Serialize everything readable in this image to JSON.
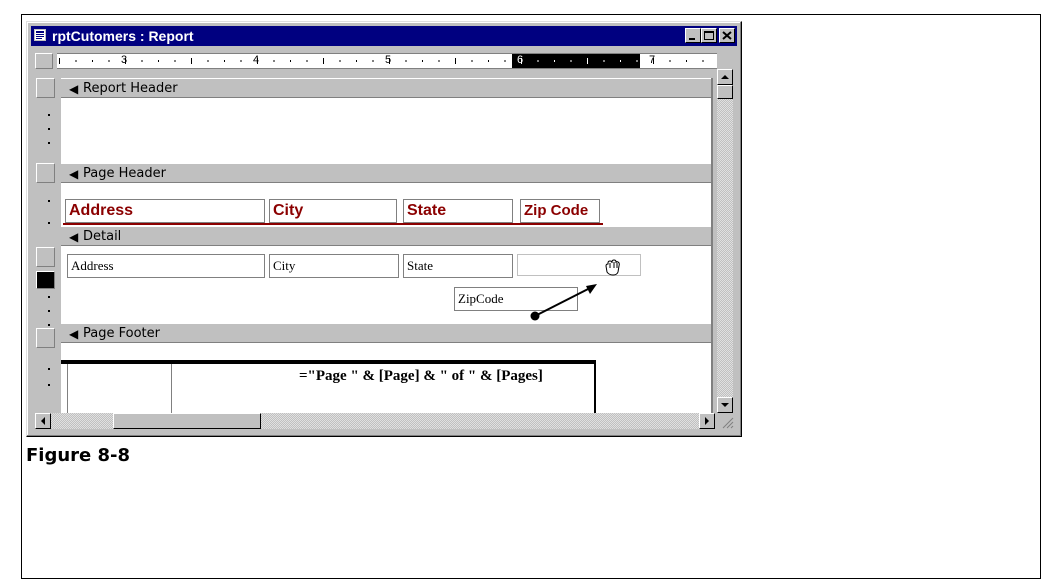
{
  "window": {
    "title": "rptCutomers : Report",
    "buttons": [
      "minimize",
      "maximize",
      "close"
    ]
  },
  "ruler": {
    "labels": [
      "3",
      "4",
      "5",
      "6",
      "7"
    ]
  },
  "sections": {
    "report_header": "Report Header",
    "page_header": "Page Header",
    "detail": "Detail",
    "page_footer": "Page Footer"
  },
  "page_header_labels": {
    "address": "Address",
    "city": "City",
    "state": "State",
    "zip": "Zip Code"
  },
  "detail_fields": {
    "address": "Address",
    "city": "City",
    "state": "State",
    "zip_moved": "ZipCode"
  },
  "page_footer": {
    "page_expression": "=\"Page \" & [Page] & \" of \" & [Pages]"
  },
  "caption": "Figure 8-8",
  "icons": {
    "window_icon": "report-icon",
    "section_icon": "section-arrow-icon",
    "cursor": "hand-grab-icon"
  },
  "colors": {
    "title_bar": "#000080",
    "label_text": "#8b0000",
    "face": "#c0c0c0"
  }
}
